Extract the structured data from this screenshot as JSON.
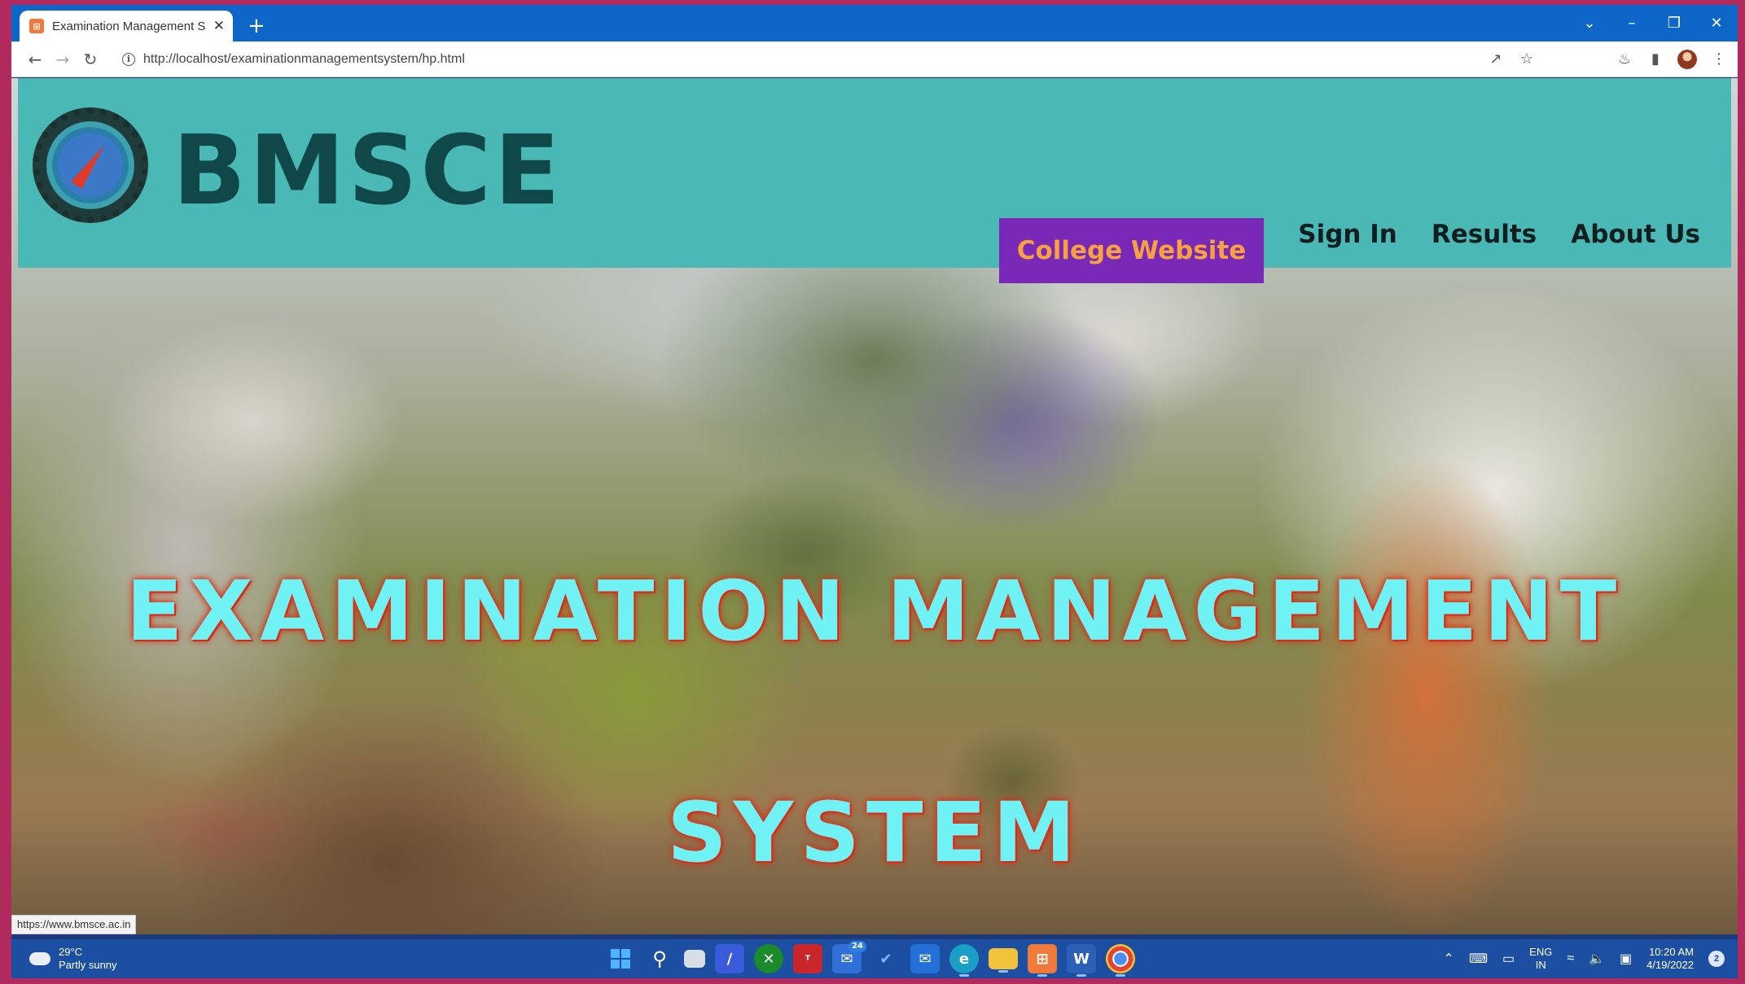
{
  "browser": {
    "tab_title": "Examination Management System",
    "tab_favicon_glyph": "⊞",
    "close_glyph": "✕",
    "new_tab_glyph": "+",
    "url": "http://localhost/examinationmanagementsystem/hp.html",
    "status_url": "https://www.bmsce.ac.in",
    "icons": [
      "back-icon",
      "forward-icon",
      "reload-icon",
      "info-icon",
      "share-icon",
      "star-icon",
      "extensions-icon",
      "side-panel-icon",
      "profile-avatar",
      "menu-icon"
    ]
  },
  "site": {
    "brand": "BMSCE",
    "nav": {
      "college_website": "College Website",
      "sign_in": "Sign In",
      "results": "Results",
      "about_us": "About Us"
    },
    "hero_line1": "EXAMINATION MANAGEMENT",
    "hero_line2": "SYSTEM"
  },
  "taskbar": {
    "weather_temp": "29°C",
    "weather_desc": "Partly sunny",
    "lang_1": "ENG",
    "lang_2": "IN",
    "time": "10:20 AM",
    "date": "4/19/2022",
    "mail_badge": "24",
    "notification_count": "2"
  },
  "colors": {
    "header_bg": "#4ab8b5",
    "brand_text": "#10484a",
    "college_btn_bg": "#7a28b8",
    "college_btn_text": "#f8a140",
    "hero_text": "#70f2f5",
    "hero_glow": "#e0341e",
    "tabbar_bg": "#0f66c9",
    "taskbar_bg": "#1c4fa1"
  }
}
